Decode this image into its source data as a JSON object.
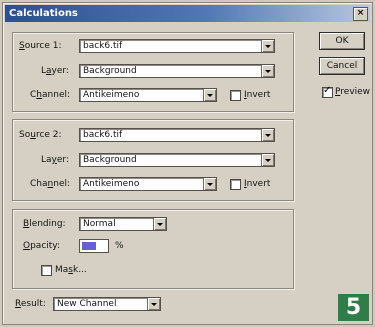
{
  "window": {
    "title": "Calculations",
    "close_glyph": "×"
  },
  "source1": {
    "label_u": "S",
    "label_rest": "ource 1:",
    "file": "back6.tif",
    "layer_label_pre": "L",
    "layer_label_u": "a",
    "layer_label_post": "yer:",
    "layer": "Background",
    "channel_label_pre": "C",
    "channel_label_u": "h",
    "channel_label_post": "annel:",
    "channel": "Antikeimeno",
    "invert_u": "I",
    "invert_rest": "nvert"
  },
  "source2": {
    "label_pre": "So",
    "label_u": "u",
    "label_post": "rce 2:",
    "file": "back6.tif",
    "layer_label_pre": "La",
    "layer_label_u": "y",
    "layer_label_post": "er:",
    "layer": "Background",
    "channel_label_pre": "Cha",
    "channel_label_u": "n",
    "channel_label_post": "nel:",
    "channel": "Antikeimeno",
    "invert_u": "I",
    "invert_rest": "nvert"
  },
  "blending": {
    "label_u": "B",
    "label_rest": "lending:",
    "mode": "Normal",
    "opacity_label_u": "O",
    "opacity_label_rest": "pacity:",
    "opacity_unit": "%",
    "mask_u": "s",
    "mask_pre": "Ma",
    "mask_post": "k..."
  },
  "result": {
    "label_u": "R",
    "label_rest": "esult:",
    "value": "New Channel"
  },
  "buttons": {
    "ok": "OK",
    "cancel": "Cancel",
    "preview_u": "P",
    "preview_rest": "review",
    "preview_checked": true
  },
  "badge": "5"
}
